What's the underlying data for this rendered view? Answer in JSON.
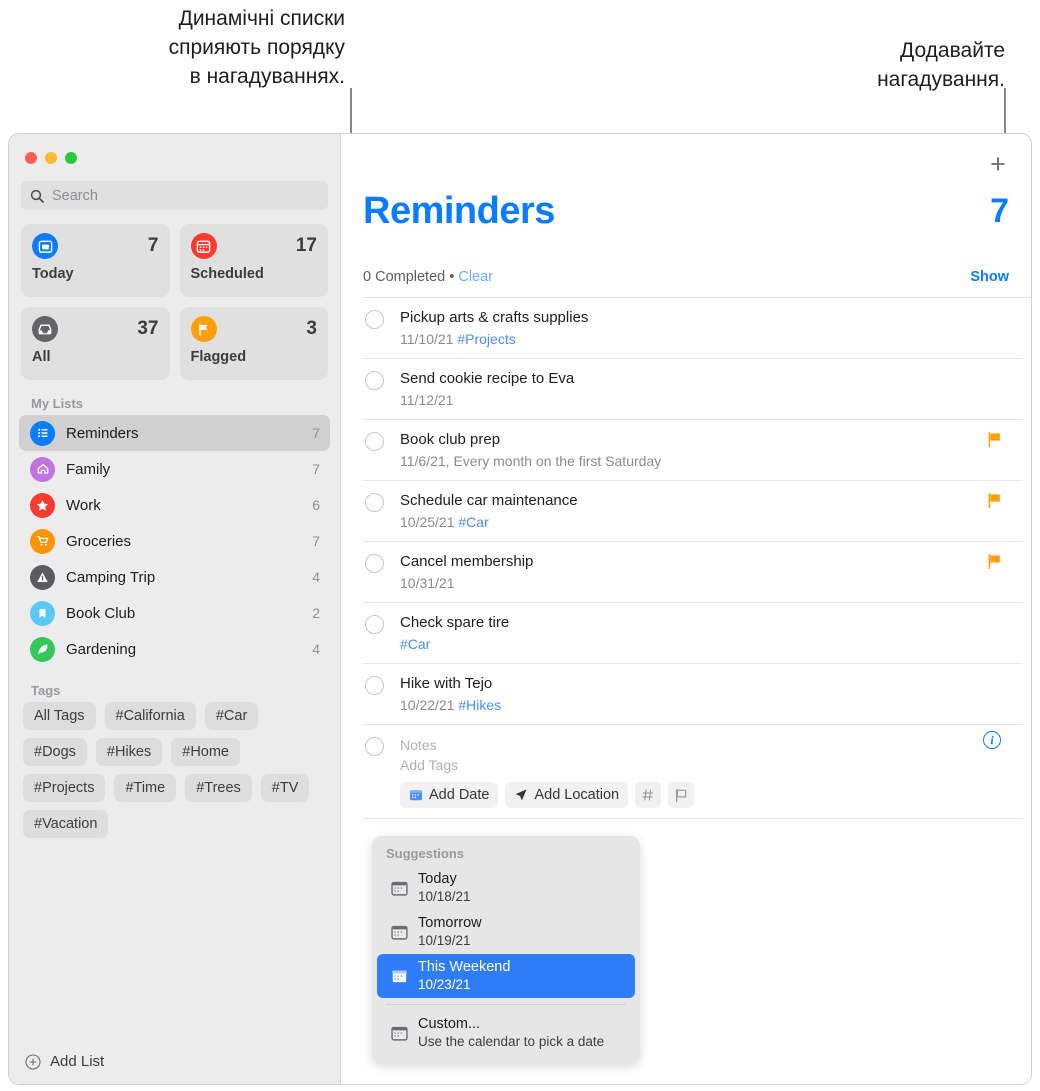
{
  "callouts": {
    "left": "Динамічні списки\nсприяють порядку\nв нагадуваннях.",
    "right": "Додавайте\nнагадування."
  },
  "window": {
    "traffic_lights": [
      "close-red",
      "minimize-yellow",
      "zoom-green"
    ]
  },
  "sidebar": {
    "search": {
      "placeholder": "Search",
      "icon": "search-icon"
    },
    "smart_lists": [
      {
        "name": "Today",
        "count": "7",
        "icon": "calendar-day-icon",
        "color": "#0a7cff"
      },
      {
        "name": "Scheduled",
        "count": "17",
        "icon": "calendar-icon",
        "color": "#ff3b30"
      },
      {
        "name": "All",
        "count": "37",
        "icon": "inbox-tray-icon",
        "color": "#636366"
      },
      {
        "name": "Flagged",
        "count": "3",
        "icon": "flag-icon",
        "color": "#ff9f0a"
      }
    ],
    "my_lists_header": "My Lists",
    "lists": [
      {
        "name": "Reminders",
        "count": "7",
        "icon": "bulleted-list-icon",
        "color": "#0a7cff",
        "selected": true
      },
      {
        "name": "Family",
        "count": "7",
        "icon": "house-icon",
        "color": "#c173e0",
        "selected": false
      },
      {
        "name": "Work",
        "count": "6",
        "icon": "star-icon",
        "color": "#ff3b30",
        "selected": false
      },
      {
        "name": "Groceries",
        "count": "7",
        "icon": "cart-icon",
        "color": "#ff9500",
        "selected": false
      },
      {
        "name": "Camping Trip",
        "count": "4",
        "icon": "tent-icon",
        "color": "#5a5a60",
        "selected": false
      },
      {
        "name": "Book Club",
        "count": "2",
        "icon": "bookmark-icon",
        "color": "#5ac8f5",
        "selected": false
      },
      {
        "name": "Gardening",
        "count": "4",
        "icon": "leaf-icon",
        "color": "#34c759",
        "selected": false
      }
    ],
    "tags_header": "Tags",
    "tags": [
      "All Tags",
      "#California",
      "#Car",
      "#Dogs",
      "#Hikes",
      "#Home",
      "#Projects",
      "#Time",
      "#Trees",
      "#TV",
      "#Vacation"
    ],
    "add_list_label": "Add List"
  },
  "main": {
    "add_reminder_icon": "plus-icon",
    "title": "Reminders",
    "count": "7",
    "completed_text": "0 Completed",
    "bullet": "•",
    "clear_label": "Clear",
    "show_label": "Show",
    "reminders": [
      {
        "title": "Pickup arts & crafts supplies",
        "date": "11/10/21",
        "tag": "#Projects",
        "flagged": false
      },
      {
        "title": "Send cookie recipe to Eva",
        "date": "11/12/21",
        "tag": "",
        "flagged": false
      },
      {
        "title": "Book club prep",
        "date": "11/6/21, Every month on the first Saturday",
        "tag": "",
        "flagged": true
      },
      {
        "title": "Schedule car maintenance",
        "date": "10/25/21",
        "tag": "#Car",
        "flagged": true
      },
      {
        "title": "Cancel membership",
        "date": "10/31/21",
        "tag": "",
        "flagged": true
      },
      {
        "title": "Check spare tire",
        "date": "",
        "tag": "#Car",
        "flagged": false
      },
      {
        "title": "Hike with Tejo",
        "date": "10/22/21",
        "tag": "#Hikes",
        "flagged": false
      }
    ],
    "editing_row": {
      "notes_placeholder": "Notes",
      "tags_placeholder": "Add Tags",
      "info_icon": "info-circle-icon",
      "buttons": [
        {
          "label": "Add Date",
          "icon": "calendar-icon"
        },
        {
          "label": "Add Location",
          "icon": "location-arrow-icon"
        },
        {
          "label": "",
          "icon": "hash-icon"
        },
        {
          "label": "",
          "icon": "flag-outline-icon"
        }
      ]
    }
  },
  "suggestions": {
    "header": "Suggestions",
    "items": [
      {
        "title": "Today",
        "sub": "10/18/21",
        "icon": "calendar-icon",
        "selected": false
      },
      {
        "title": "Tomorrow",
        "sub": "10/19/21",
        "icon": "calendar-icon",
        "selected": false
      },
      {
        "title": "This Weekend",
        "sub": "10/23/21",
        "icon": "calendar-icon",
        "selected": true
      },
      {
        "title": "Custom...",
        "sub": "Use the calendar to pick a date",
        "icon": "calendar-icon",
        "selected": false
      }
    ]
  },
  "colors": {
    "accent": "#0a7cff",
    "selection": "#2f7cf6",
    "flag": "#ff9f0a",
    "sidebar_bg": "#ececec"
  }
}
